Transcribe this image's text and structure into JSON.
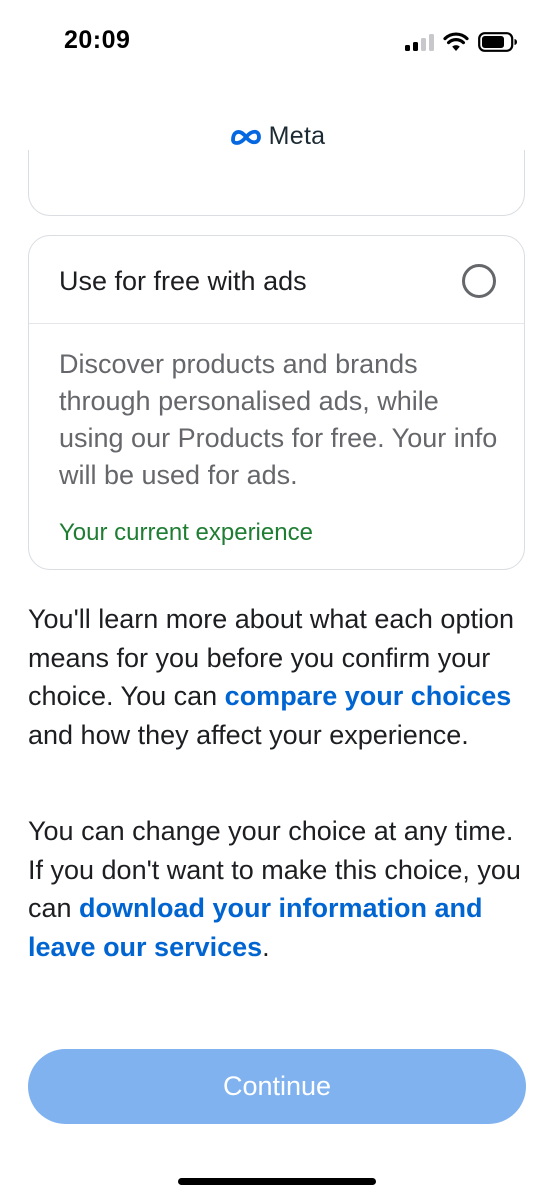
{
  "status_bar": {
    "time": "20:09",
    "icons": [
      "cellular-signal-icon",
      "wifi-icon",
      "battery-icon"
    ]
  },
  "header": {
    "logo_icon": "meta-infinity-icon",
    "logo_text": "Meta"
  },
  "option": {
    "title": "Use for free with ads",
    "selected": false,
    "description": "Discover products and brands through personalised ads, while using our Products for free. Your info will be used for ads.",
    "status": "Your current experience"
  },
  "info": {
    "p1_text_1": "You'll learn more about what each option means for you before you confirm your choice. You can ",
    "p1_link": "compare your choices",
    "p1_text_2": " and how they affect your experience.",
    "p2_text_1": "You can change your choice at any time. If you don't want to make this choice, you can ",
    "p2_link": "download your information and leave our services",
    "p2_text_2": "."
  },
  "footer": {
    "continue_label": "Continue"
  },
  "colors": {
    "link": "#0064d1",
    "status_green": "#1e7d32",
    "button_disabled": "#7fb2ef",
    "meta_blue": "#0668e1"
  }
}
